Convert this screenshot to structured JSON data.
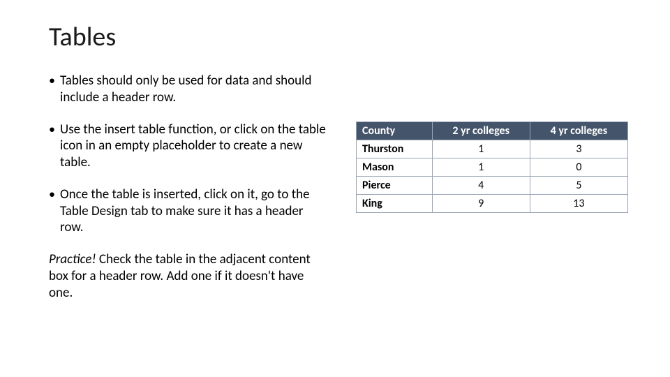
{
  "title": "Tables",
  "bullets": {
    "0": "Tables should only be used for data and should include a header row.",
    "1": "Use the insert table function, or click on the table icon in an empty placeholder to create a new table.",
    "2": "Once the table is inserted, click on it, go to the Table Design tab to make sure it has a header row."
  },
  "practice": {
    "lead": "Practice!",
    "rest": " Check the table in the adjacent content box for a header row. Add one if it doesn't have one."
  },
  "table": {
    "headers": {
      "county": "County",
      "col2": "2 yr colleges",
      "col4": "4 yr colleges"
    },
    "rows": {
      "0": {
        "county": "Thurston",
        "c2": "1",
        "c4": "3"
      },
      "1": {
        "county": "Mason",
        "c2": "1",
        "c4": "0"
      },
      "2": {
        "county": "Pierce",
        "c2": "4",
        "c4": "5"
      },
      "3": {
        "county": "King",
        "c2": "9",
        "c4": "13"
      }
    }
  },
  "chart_data": {
    "type": "table",
    "title": "Tables",
    "columns": [
      "County",
      "2 yr colleges",
      "4 yr colleges"
    ],
    "rows": [
      [
        "Thurston",
        1,
        3
      ],
      [
        "Mason",
        1,
        0
      ],
      [
        "Pierce",
        4,
        5
      ],
      [
        "King",
        9,
        13
      ]
    ]
  }
}
